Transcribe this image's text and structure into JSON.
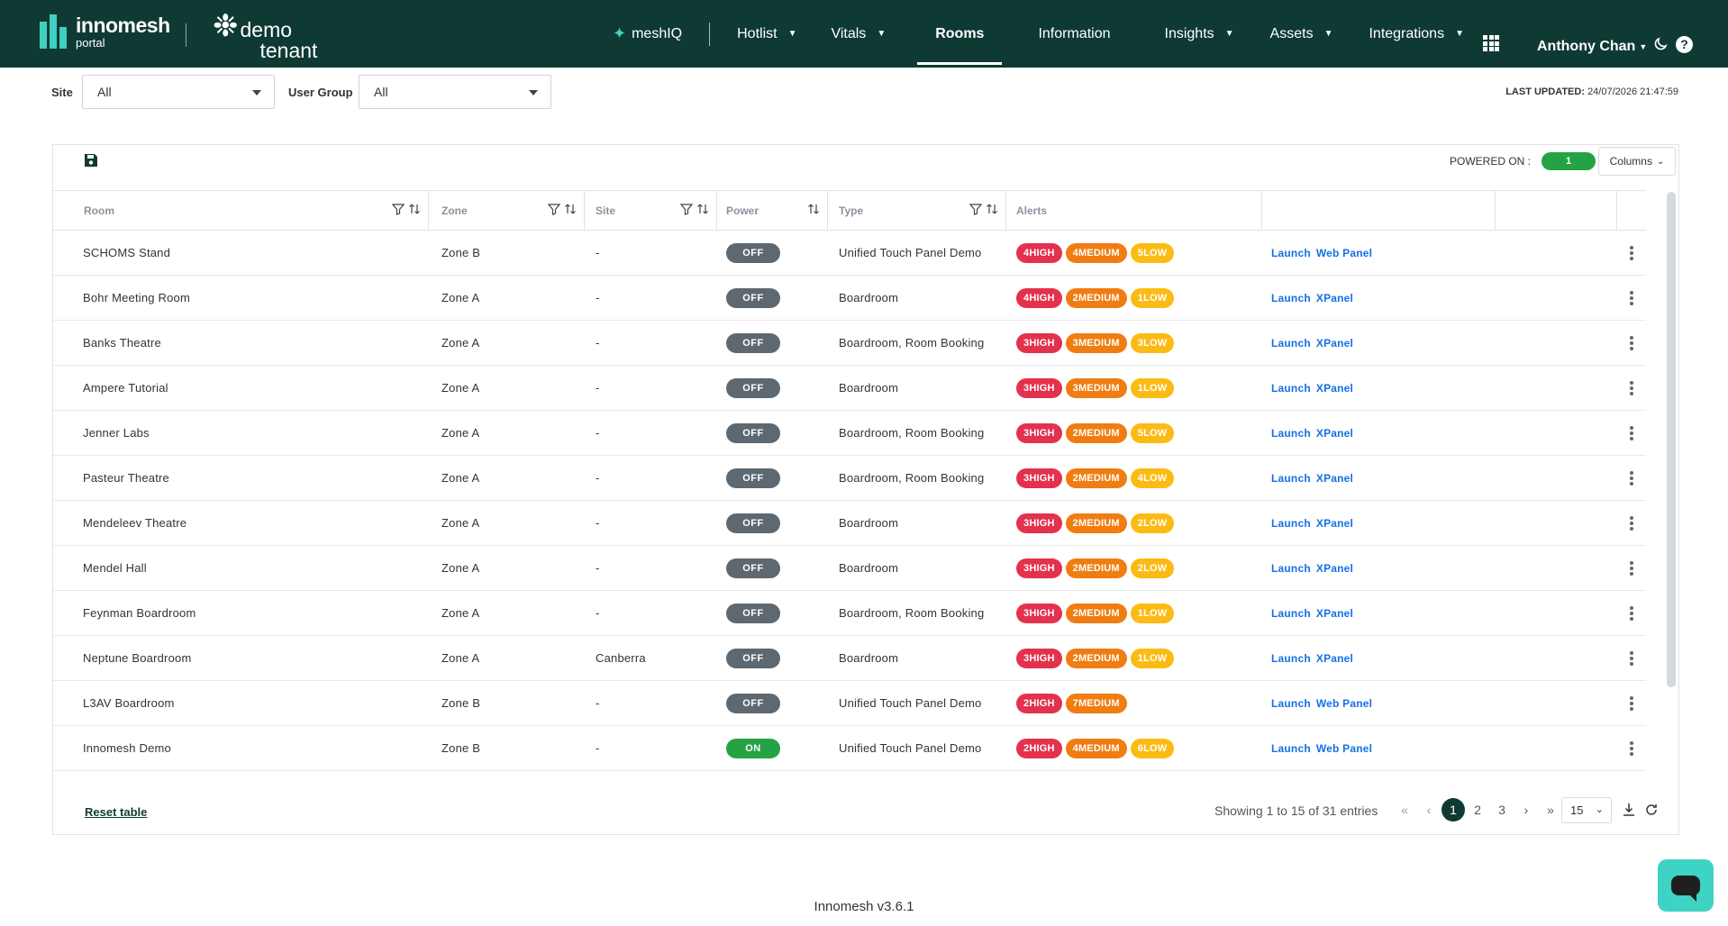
{
  "header": {
    "brand_name": "innomesh",
    "brand_sub": "portal",
    "tenant_line1": "demo",
    "tenant_line2": "tenant",
    "nav": {
      "meshiq": "meshIQ",
      "hotlist": "Hotlist",
      "vitals": "Vitals",
      "rooms": "Rooms",
      "information": "Information",
      "insights": "Insights",
      "assets": "Assets",
      "integrations": "Integrations"
    },
    "user_name": "Anthony Chan",
    "help_glyph": "?"
  },
  "filters": {
    "site_label": "Site",
    "site_value": "All",
    "user_group_label": "User Group",
    "user_group_value": "All",
    "last_updated_label": "LAST UPDATED:",
    "last_updated_value": "24/07/2026 21:47:59"
  },
  "toolbar": {
    "powered_on_label": "POWERED ON :",
    "powered_on_count": "1",
    "columns_label": "Columns"
  },
  "table": {
    "headers": {
      "room": "Room",
      "zone": "Zone",
      "site": "Site",
      "power": "Power",
      "type": "Type",
      "alerts": "Alerts"
    },
    "launch_label": "Launch",
    "rows": [
      {
        "room": "SCHOMS Stand",
        "zone": "Zone B",
        "site": "-",
        "power": "OFF",
        "type": "Unified Touch Panel Demo",
        "high": "4HIGH",
        "medium": "4MEDIUM",
        "low": "5LOW",
        "panel": "Web Panel"
      },
      {
        "room": "Bohr Meeting Room",
        "zone": "Zone A",
        "site": "-",
        "power": "OFF",
        "type": "Boardroom",
        "high": "4HIGH",
        "medium": "2MEDIUM",
        "low": "1LOW",
        "panel": "XPanel"
      },
      {
        "room": "Banks Theatre",
        "zone": "Zone A",
        "site": "-",
        "power": "OFF",
        "type": "Boardroom, Room Booking",
        "high": "3HIGH",
        "medium": "3MEDIUM",
        "low": "3LOW",
        "panel": "XPanel"
      },
      {
        "room": "Ampere Tutorial",
        "zone": "Zone A",
        "site": "-",
        "power": "OFF",
        "type": "Boardroom",
        "high": "3HIGH",
        "medium": "3MEDIUM",
        "low": "1LOW",
        "panel": "XPanel"
      },
      {
        "room": "Jenner Labs",
        "zone": "Zone A",
        "site": "-",
        "power": "OFF",
        "type": "Boardroom, Room Booking",
        "high": "3HIGH",
        "medium": "2MEDIUM",
        "low": "5LOW",
        "panel": "XPanel"
      },
      {
        "room": "Pasteur Theatre",
        "zone": "Zone A",
        "site": "-",
        "power": "OFF",
        "type": "Boardroom, Room Booking",
        "high": "3HIGH",
        "medium": "2MEDIUM",
        "low": "4LOW",
        "panel": "XPanel"
      },
      {
        "room": "Mendeleev Theatre",
        "zone": "Zone A",
        "site": "-",
        "power": "OFF",
        "type": "Boardroom",
        "high": "3HIGH",
        "medium": "2MEDIUM",
        "low": "2LOW",
        "panel": "XPanel"
      },
      {
        "room": "Mendel Hall",
        "zone": "Zone A",
        "site": "-",
        "power": "OFF",
        "type": "Boardroom",
        "high": "3HIGH",
        "medium": "2MEDIUM",
        "low": "2LOW",
        "panel": "XPanel"
      },
      {
        "room": "Feynman Boardroom",
        "zone": "Zone A",
        "site": "-",
        "power": "OFF",
        "type": "Boardroom, Room Booking",
        "high": "3HIGH",
        "medium": "2MEDIUM",
        "low": "1LOW",
        "panel": "XPanel"
      },
      {
        "room": "Neptune Boardroom",
        "zone": "Zone A",
        "site": "Canberra",
        "power": "OFF",
        "type": "Boardroom",
        "high": "3HIGH",
        "medium": "2MEDIUM",
        "low": "1LOW",
        "panel": "XPanel"
      },
      {
        "room": "L3AV Boardroom",
        "zone": "Zone B",
        "site": "-",
        "power": "OFF",
        "type": "Unified Touch Panel Demo",
        "high": "2HIGH",
        "medium": "7MEDIUM",
        "low": "",
        "panel": "Web Panel"
      },
      {
        "room": "Innomesh Demo",
        "zone": "Zone B",
        "site": "-",
        "power": "ON",
        "type": "Unified Touch Panel Demo",
        "high": "2HIGH",
        "medium": "4MEDIUM",
        "low": "6LOW",
        "panel": "Web Panel"
      }
    ]
  },
  "pagination": {
    "reset_label": "Reset table",
    "showing_text": "Showing 1 to 15 of 31 entries",
    "pages": [
      "1",
      "2",
      "3"
    ],
    "current_page": "1",
    "page_size": "15"
  },
  "footer": {
    "version": "Innomesh v3.6.1"
  },
  "colors": {
    "header_bg": "#0f3a34",
    "accent": "#3fd0c0",
    "high": "#e3324e",
    "medium": "#f07d12",
    "low": "#fcbb14",
    "on": "#25a244",
    "off": "#5e6870",
    "link": "#1470e6"
  }
}
